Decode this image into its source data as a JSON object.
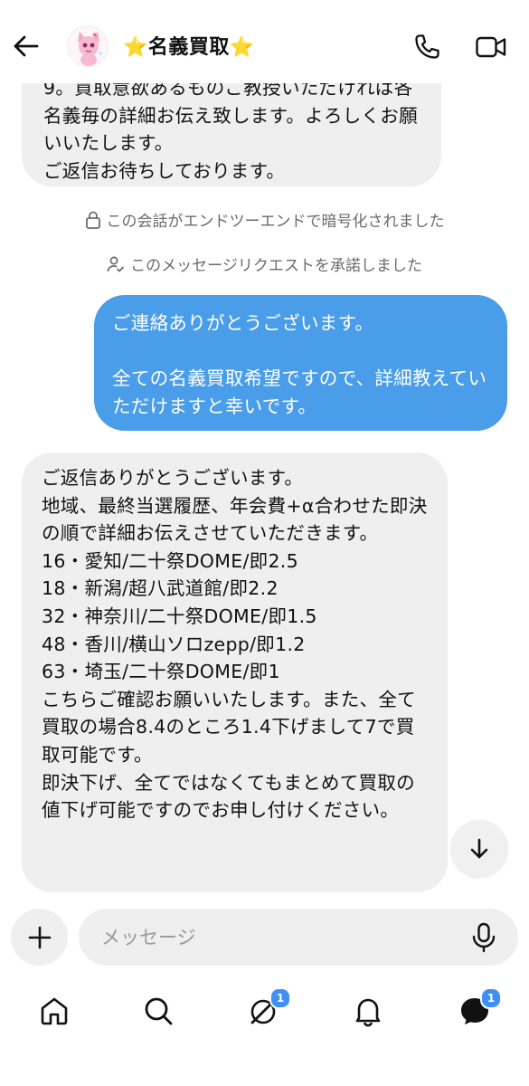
{
  "header": {
    "title": "⭐名義買取⭐",
    "avatar": "pink-cat-avatar"
  },
  "messages": [
    {
      "direction": "incoming",
      "text": "9。買取意欲あるものご教授いただければ各名義毎の詳細お伝え致します。よろしくお願いいたします。\nご返信お待ちしております。"
    },
    {
      "direction": "outgoing",
      "text": "ご連絡ありがとうございます。\n\n全ての名義買取希望ですので、詳細教えていただけますと幸いです。"
    },
    {
      "direction": "incoming",
      "text": "ご返信ありがとうございます。\n地域、最終当選履歴、年会費+α合わせた即決の順で詳細お伝えさせていただきます。\n16・愛知/二十祭DOME/即2.5\n18・新潟/超八武道館/即2.2\n32・神奈川/二十祭DOME/即1.5\n48・香川/横山ソロzepp/即1.2\n63・埼玉/二十祭DOME/即1\nこちらご確認お願いいたします。また、全て買取の場合8.4のところ1.4下げまして7で買取可能です。\n即決下げ、全てではなくてもまとめて買取の値下げ可能ですのでお申し付けください。"
    }
  ],
  "system": {
    "encrypted_notice": "この会話がエンドツーエンドで暗号化されました",
    "request_accepted": "このメッセージリクエストを承諾しました"
  },
  "composer": {
    "placeholder": "メッセージ"
  },
  "nav": {
    "messages_badge": "1",
    "inbox_badge": "1"
  },
  "colors": {
    "outgoing_bubble": "#4a9de8",
    "incoming_bubble": "#efefef",
    "badge": "#3f8ff5"
  }
}
